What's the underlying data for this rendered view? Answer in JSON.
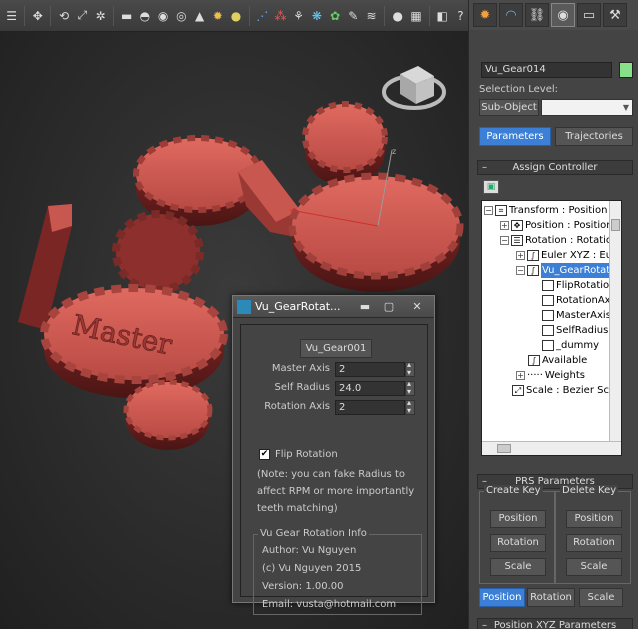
{
  "toolbar": {
    "icons": [
      "select-icon",
      "move-icon",
      "rotate-icon",
      "scale-icon",
      "box-icon",
      "sphere-icon",
      "cylinder-icon",
      "torus-icon",
      "cone-icon",
      "sun-icon",
      "light-icon",
      "particles-icon",
      "lattice-icon",
      "scatter-icon",
      "grass-icon",
      "bush-icon",
      "paint-icon",
      "camera-icon",
      "sphere2-icon",
      "render-icon",
      "settings-icon",
      "help-icon"
    ]
  },
  "viewport": {
    "gear_text": "Master",
    "axis_label": "z"
  },
  "command_panel": {
    "object_name": "Vu_Gear014",
    "object_color": "#88e088",
    "selection_level_label": "Selection Level:",
    "sub_object_label": "Sub-Object",
    "tabs": {
      "parameters": "Parameters",
      "trajectories": "Trajectories"
    },
    "assign_controller_title": "Assign Controller",
    "tree": [
      {
        "label": "Transform : Position"
      },
      {
        "label": "Position : Position"
      },
      {
        "label": "Rotation : Rotation"
      },
      {
        "label": "Euler XYZ : Eu"
      },
      {
        "label": "Vu_GearRotat"
      },
      {
        "label": "FlipRotation"
      },
      {
        "label": "RotationAx"
      },
      {
        "label": "MasterAxis"
      },
      {
        "label": "SelfRadius"
      },
      {
        "label": "_dummy"
      },
      {
        "label": "Available"
      },
      {
        "label": "Weights"
      },
      {
        "label": "Scale : Bezier Sca"
      }
    ],
    "prs_title": "PRS Parameters",
    "create_key": {
      "title": "Create Key",
      "buttons": [
        "Position",
        "Rotation",
        "Scale"
      ]
    },
    "delete_key": {
      "title": "Delete Key",
      "buttons": [
        "Position",
        "Rotation",
        "Scale"
      ]
    },
    "bottom_tabs": [
      "Position",
      "Rotation",
      "Scale"
    ],
    "next_rollout": "Position XYZ Parameters"
  },
  "dialog": {
    "title": "Vu_GearRotat...",
    "target_button": "Vu_Gear001",
    "master_axis_label": "Master Axis",
    "master_axis_value": "2",
    "self_radius_label": "Self Radius",
    "self_radius_value": "24.0",
    "rotation_axis_label": "Rotation Axis",
    "rotation_axis_value": "2",
    "flip_rotation_label": "Flip Rotation",
    "flip_rotation_checked": true,
    "note_line1": "(Note: you can fake Radius to",
    "note_line2": "affect RPM or more importantly",
    "note_line3": "teeth matching)",
    "info_title": "Vu Gear Rotation Info",
    "author": "Author: Vu Nguyen",
    "copyright": "(c) Vu Nguyen 2015",
    "version": "Version: 1.00.00",
    "email": "Email: vusta@hotmail.com"
  }
}
